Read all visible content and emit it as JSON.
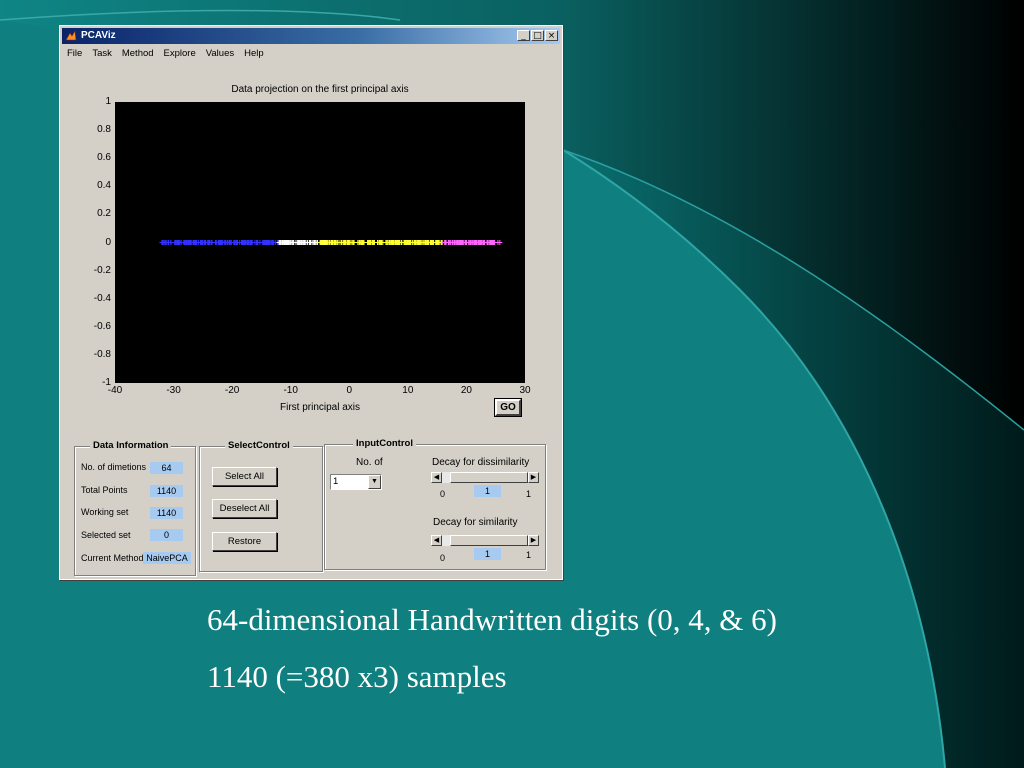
{
  "window": {
    "title": "PCAViz",
    "controls": [
      "_",
      "□",
      "×"
    ]
  },
  "menu": [
    "File",
    "Task",
    "Method",
    "Explore",
    "Values",
    "Help"
  ],
  "chart_data": {
    "type": "scatter",
    "title": "Data projection on the first principal axis",
    "xlabel": "First principal axis",
    "ylabel": "",
    "xlim": [
      -40,
      30
    ],
    "ylim": [
      -1,
      1
    ],
    "xticks": [
      "-40",
      "-30",
      "-20",
      "-10",
      "0",
      "10",
      "20",
      "30"
    ],
    "yticks": [
      "1",
      "0.8",
      "0.6",
      "0.4",
      "0.2",
      "0",
      "-0.2",
      "-0.4",
      "-0.6",
      "-0.8",
      "-1"
    ],
    "background": "#000000",
    "series": [
      {
        "color": "#3333ff",
        "marker": "+",
        "x_range": [
          -32,
          -12
        ],
        "y": 0
      },
      {
        "color": "#ffffff",
        "marker": "+",
        "x_range": [
          -12,
          -4
        ],
        "y": 0
      },
      {
        "color": "#ffff33",
        "marker": "+",
        "x_range": [
          -5,
          16
        ],
        "y": 0
      },
      {
        "color": "#ff66ff",
        "marker": "+",
        "x_range": [
          16,
          26
        ],
        "y": 0
      }
    ]
  },
  "go_button": "GO",
  "data_information": {
    "title": "Data Information",
    "rows": [
      {
        "label": "No. of dimetions",
        "value": "64"
      },
      {
        "label": "Total Points",
        "value": "1140"
      },
      {
        "label": "Working set",
        "value": "1140"
      },
      {
        "label": "Selected set",
        "value": "0"
      },
      {
        "label": "Current Method",
        "value": "NaivePCA"
      }
    ]
  },
  "select_control": {
    "title": "SelectControl",
    "buttons": [
      "Select All",
      "Deselect All",
      "Restore"
    ]
  },
  "input_control": {
    "title": "InputControl",
    "no_of_label": "No. of",
    "no_of_value": "1",
    "dissimilarity": {
      "label": "Decay for dissimilarity",
      "min": "0",
      "value": "1",
      "max": "1",
      "level": 1.0
    },
    "similarity": {
      "label": "Decay for similarity",
      "min": "0",
      "value": "1",
      "max": "1",
      "level": 1.0
    }
  },
  "slide": {
    "line1": "64-dimensional Handwritten digits (0, 4, & 6)",
    "line2": "1140 (=380 x3) samples"
  },
  "colors": {
    "teal": "#0f7f7f",
    "dark": "#000000",
    "window": "#d4d0c8",
    "titlebar": "#0a246a",
    "value_box": "#a6caf0"
  }
}
